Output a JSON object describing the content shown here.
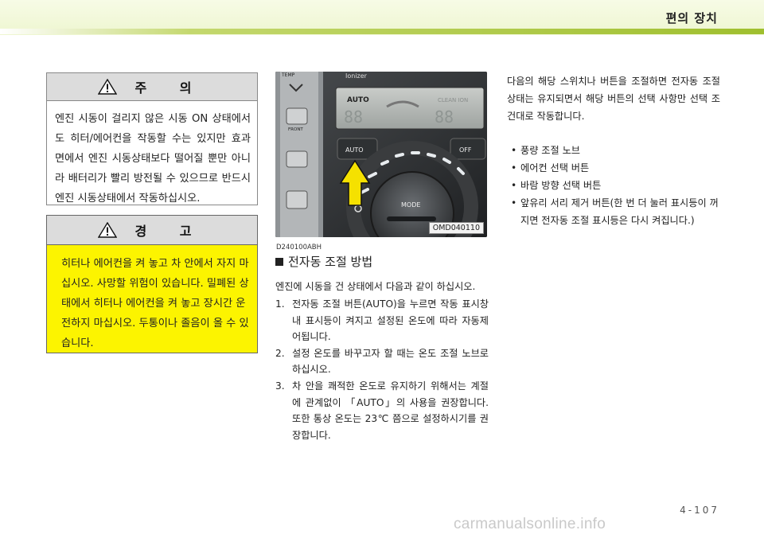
{
  "header": {
    "section_title": "편의 장치"
  },
  "caution": {
    "title": "주 의",
    "icon": "warning-triangle-icon",
    "text": "엔진 시동이 걸리지 않은 시동 ON 상태에서 도 히터/에어컨을 작동할 수는 있지만 효과 면에서 엔진 시동상태보다 떨어질 뿐만 아니 라 배터리가 빨리 방전될 수 있으므로 반드시 엔진 시동상태에서 작동하십시오."
  },
  "warning": {
    "title": "경 고",
    "icon": "warning-triangle-icon",
    "text": "히터나 에어컨을 켜 놓고 차 안에서 자지 마십시오. 사망할 위험이 있습니다. 밀폐된 상태에서 히터나 에어컨을 켜 놓고 장시간 운전하지 마십시오. 두통이나 졸음이 올 수 있습니다."
  },
  "photo": {
    "code": "OMD040110",
    "panel_labels": {
      "temp": "TEMP",
      "ionizer": "Ionizer",
      "auto_display": "AUTO",
      "clean_ion": "CLEAN ION",
      "front": "FRONT",
      "auto_button": "AUTO",
      "off_button": "OFF",
      "mode": "MODE"
    }
  },
  "doc_code": "D240100ABH",
  "subheading": "전자동 조절 방법",
  "intro": "엔진에 시동을 건 상태에서 다음과 같이 하십시오.",
  "steps": [
    {
      "num": "1.",
      "text": "전자동 조절 버튼(AUTO)을 누르면 작동 표시창내 표시등이 켜지고 설정된 온도에 따라 자동제어됩니다."
    },
    {
      "num": "2.",
      "text": "설정 온도를 바꾸고자 할 때는 온도 조절 노브로 하십시오."
    },
    {
      "num": "3.",
      "text": "차 안을 쾌적한 온도로 유지하기 위해서는 계절에 관계없이 「AUTO」의 사용을 권장합니다. 또한 통상 온도는 23℃ 쯤으로 설정하시기를 권장합니다."
    }
  ],
  "right": {
    "intro": "다음의 해당 스위치나 버튼을 조절하면 전자동 조절 상태는 유지되면서 해당 버튼의 선택 사항만 선택 조건대로 작동합니다.",
    "bullets": [
      "풍량 조절 노브",
      "에어컨 선택 버튼",
      "바람 방향 선택 버튼",
      "앞유리 서리 제거 버튼(한 번 더 눌러 표시등이 꺼지면 전자동 조절 표시등은 다시 켜집니다.)"
    ]
  },
  "footer": {
    "page_number": "4-107",
    "watermark": "carmanualsonline.info"
  }
}
